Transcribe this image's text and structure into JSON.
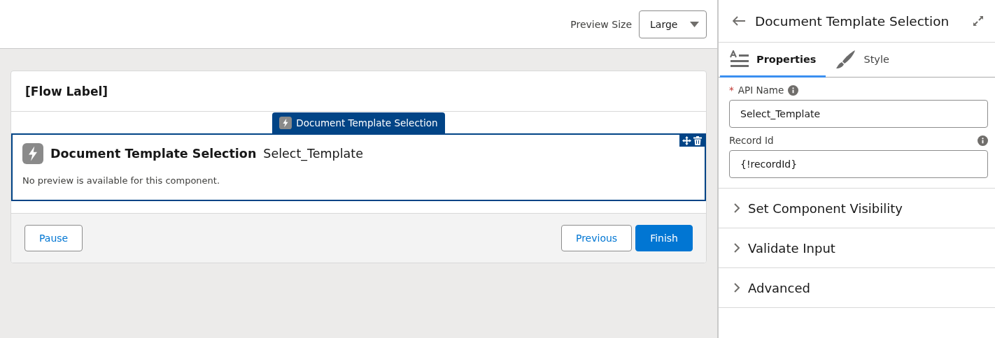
{
  "preview_size": {
    "label": "Preview Size",
    "value": "Large"
  },
  "flow": {
    "label": "[Flow Label]",
    "component": {
      "tab_label": "Document Template Selection",
      "type_label": "Document Template Selection",
      "api_name": "Select_Template",
      "message": "No preview is available for this component.",
      "selected": true
    },
    "left_buttons": [
      {
        "label": "Pause",
        "kind": "neutral"
      }
    ],
    "right_buttons": [
      {
        "label": "Previous",
        "kind": "neutral"
      },
      {
        "label": "Finish",
        "kind": "brand"
      }
    ]
  },
  "panel": {
    "title": "Document Template Selection",
    "tabs": [
      {
        "label": "Properties",
        "kind": "properties",
        "selected": true
      },
      {
        "label": "Style",
        "kind": "style",
        "selected": false
      }
    ],
    "fields": [
      {
        "required_mark": "*",
        "label": "API Name",
        "value": "Select_Template"
      },
      {
        "label": "Record Id",
        "value": "{!recordId}"
      }
    ],
    "sections": [
      {
        "label": "Set Component Visibility",
        "expanded": false
      },
      {
        "label": "Validate Input",
        "expanded": false
      },
      {
        "label": "Advanced",
        "expanded": false
      }
    ]
  }
}
